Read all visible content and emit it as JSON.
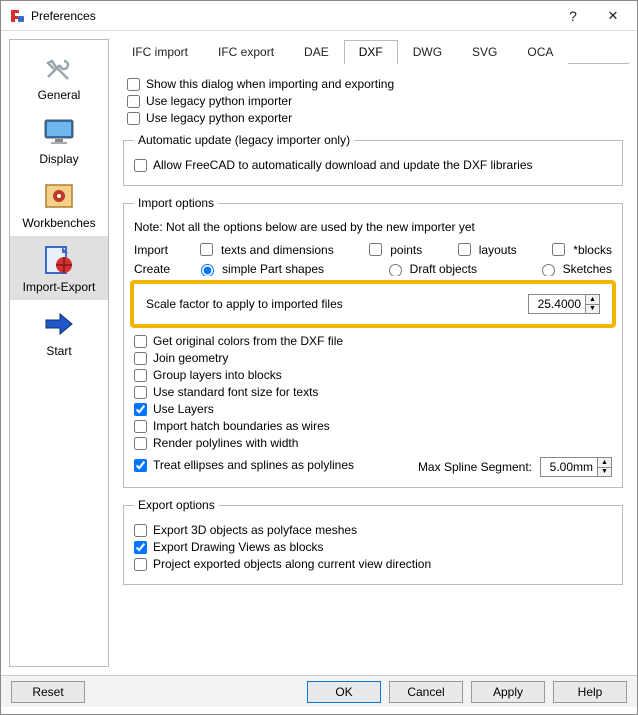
{
  "titlebar": {
    "title": "Preferences"
  },
  "sidebar": {
    "items": [
      {
        "label": "General"
      },
      {
        "label": "Display"
      },
      {
        "label": "Workbenches"
      },
      {
        "label": "Import-Export"
      },
      {
        "label": "Start"
      }
    ]
  },
  "tabs": [
    "IFC import",
    "IFC export",
    "DAE",
    "DXF",
    "DWG",
    "SVG",
    "OCA"
  ],
  "top_checks": {
    "show_dialog": "Show this dialog when importing and exporting",
    "legacy_importer": "Use legacy python importer",
    "legacy_exporter": "Use legacy python exporter"
  },
  "auto_update": {
    "legend": "Automatic update (legacy importer only)",
    "allow": "Allow FreeCAD to automatically download and update the DXF libraries"
  },
  "import": {
    "legend": "Import options",
    "note": "Note: Not all the options below are used by the new importer yet",
    "import_label": "Import",
    "import_opts": {
      "texts": "texts and dimensions",
      "points": "points",
      "layouts": "layouts",
      "blocks": "*blocks"
    },
    "create_label": "Create",
    "create_opts": {
      "simple": "simple Part shapes",
      "draft": "Draft objects",
      "sketches": "Sketches"
    },
    "scale_label": "Scale factor to apply to imported files",
    "scale_value": "25.4000",
    "original_colors": "Get original colors from the DXF file",
    "join_geometry": "Join geometry",
    "group_layers": "Group layers into blocks",
    "std_font": "Use standard font size for texts",
    "use_layers": "Use Layers",
    "hatch_wires": "Import hatch boundaries as wires",
    "render_polylines": "Render polylines with width",
    "ellipses_polylines": "Treat ellipses and splines as polylines",
    "max_spline_label": "Max Spline Segment:",
    "max_spline_value": "5.00mm"
  },
  "export": {
    "legend": "Export options",
    "polyface": "Export 3D objects as polyface meshes",
    "drawing_views": "Export Drawing Views as blocks",
    "project_direction": "Project exported objects along current view direction"
  },
  "footer": {
    "reset": "Reset",
    "ok": "OK",
    "cancel": "Cancel",
    "apply": "Apply",
    "help": "Help"
  }
}
